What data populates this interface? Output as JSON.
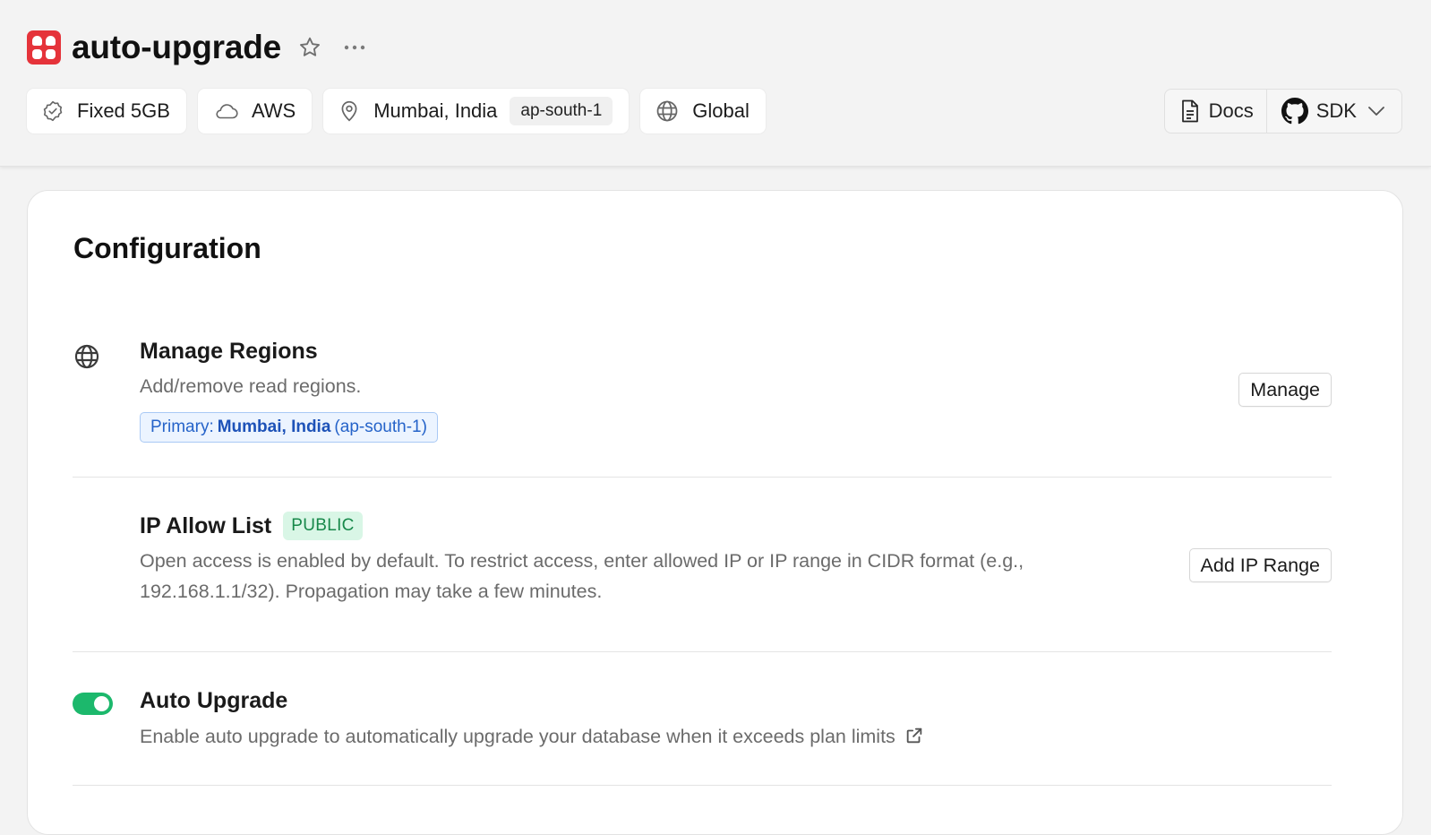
{
  "header": {
    "title": "auto-upgrade",
    "icons": {
      "logo": "database-logo-icon",
      "star": "star-icon",
      "more": "more-dots-icon"
    },
    "chips": [
      {
        "icon": "badge-check-icon",
        "label": "Fixed 5GB"
      },
      {
        "icon": "cloud-icon",
        "label": "AWS"
      },
      {
        "icon": "map-pin-icon",
        "label": "Mumbai, India",
        "tag": "ap-south-1"
      },
      {
        "icon": "globe-icon",
        "label": "Global"
      }
    ],
    "docs_label": "Docs",
    "sdk_label": "SDK"
  },
  "configuration": {
    "title": "Configuration",
    "manage_regions": {
      "icon": "globe-icon",
      "title": "Manage Regions",
      "description": "Add/remove read regions.",
      "primary_prefix": "Primary:",
      "primary_region": "Mumbai, India",
      "primary_code": "(ap-south-1)",
      "button": "Manage"
    },
    "ip_allow_list": {
      "title": "IP Allow List",
      "badge": "PUBLIC",
      "description_line1": "Open access is enabled by default. To restrict access, enter allowed IP or IP range in CIDR format (e.g.,",
      "description_line2": "192.168.1.1/32). Propagation may take a few minutes.",
      "button": "Add IP Range"
    },
    "auto_upgrade": {
      "title": "Auto Upgrade",
      "description": "Enable auto upgrade to automatically upgrade your database when it exceeds plan limits",
      "enabled": true,
      "external_icon": "external-link-icon"
    }
  },
  "colors": {
    "brand": "#e5333a",
    "toggle_on": "#1cb86c",
    "primary_tag_text": "#2563c9",
    "public_badge_bg": "#d9f6e6",
    "public_badge_text": "#17884a"
  }
}
